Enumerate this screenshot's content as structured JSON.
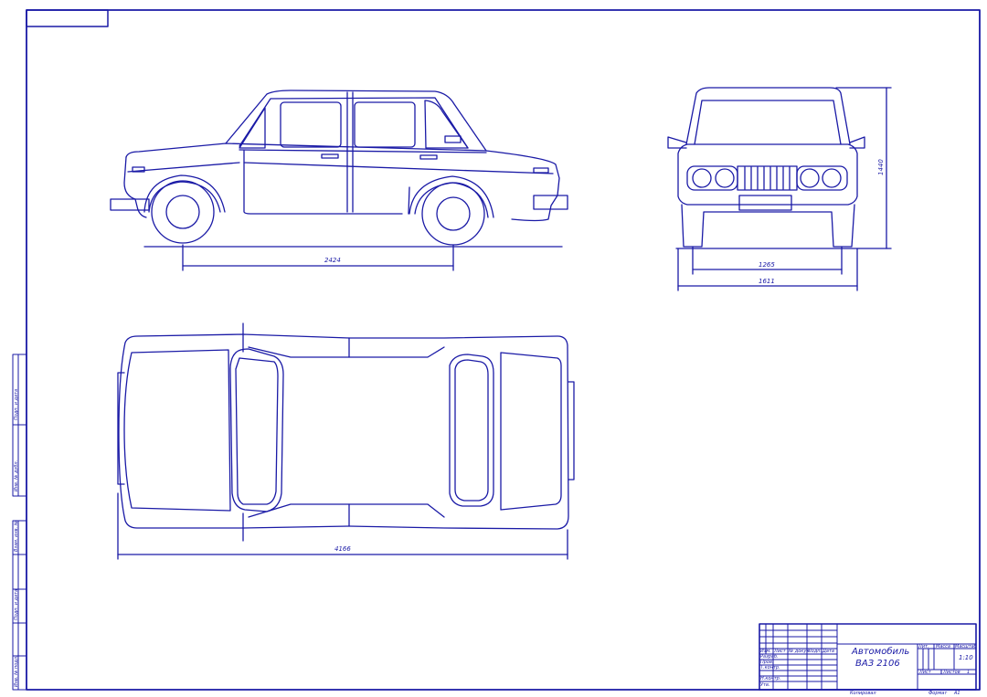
{
  "colors": {
    "line": "#1a1aa6",
    "background": "#ffffff"
  },
  "dimensions": {
    "wheelbase": "2424",
    "front_track": "1265",
    "overall_width": "1611",
    "overall_height": "1440",
    "overall_length": "4166"
  },
  "title_block": {
    "title_line1": "Автомобиль",
    "title_line2": "ВАЗ 2106",
    "scale": "1:10",
    "sheet": "Лист",
    "mass": "Масса",
    "scale_label": "Масштаб",
    "sheets": "Листов",
    "sheets_count": "1",
    "lit": "Лит.",
    "rows": [
      "Разраб.",
      "Пров.",
      "Т.контр.",
      "Н.контр.",
      "Утв."
    ],
    "headers": [
      "Изм.",
      "Лист",
      "№ докум.",
      "Подп.",
      "Дата"
    ],
    "copied": "Копировал",
    "format": "Формат",
    "format_value": "А1"
  },
  "side_stamp": {
    "cells": [
      "Подп. и дата",
      "Инв. № дубл.",
      "Взам. инв. №",
      "Подп. и дата",
      "Инв. № подл."
    ]
  }
}
